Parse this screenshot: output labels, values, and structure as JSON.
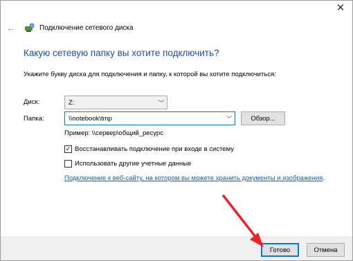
{
  "window": {
    "title": "Подключение сетевого диска",
    "close_label": "✕"
  },
  "heading": "Какую сетевую папку вы хотите подключить?",
  "description": "Укажите букву диска для подключения и папку, к которой вы хотите подключиться:",
  "drive": {
    "label": "Диск:",
    "value": "Z:"
  },
  "folder": {
    "label": "Папка:",
    "value": "\\\\notebook\\tmp"
  },
  "browse_label": "Обзор...",
  "example": "Пример: \\\\сервер\\общий_ресурс",
  "reconnect": {
    "label": "Восстанавливать подключение при входе в систему",
    "checked": true
  },
  "other_credentials": {
    "label": "Использовать другие учетные данные",
    "checked": false
  },
  "link": "Подключение к веб-сайту, на котором вы можете хранить документы и изображения",
  "link_suffix": ".",
  "buttons": {
    "finish": "Готово",
    "cancel": "Отмена"
  },
  "colors": {
    "accent": "#0078d7",
    "heading": "#1c4fa0",
    "annotation_arrow": "#e8262a"
  }
}
